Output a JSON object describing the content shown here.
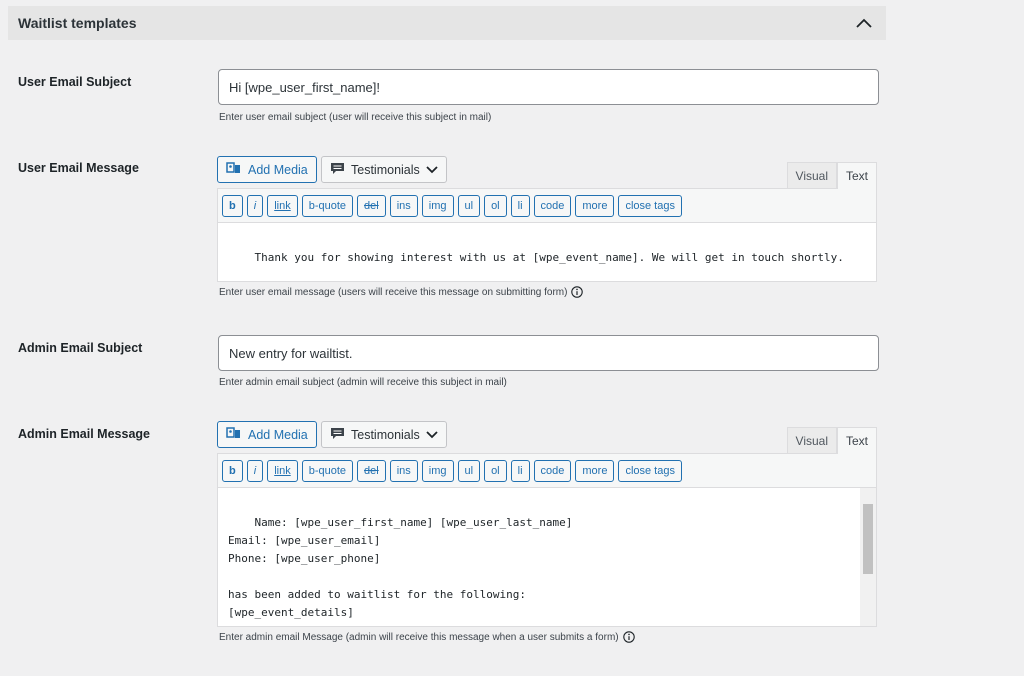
{
  "panel": {
    "title": "Waitlist templates",
    "collapse_icon": "chevron-up-icon"
  },
  "user_subject": {
    "label": "User Email Subject",
    "value": "Hi [wpe_user_first_name]!",
    "help": "Enter user email subject (user will receive this subject in mail)"
  },
  "user_message": {
    "label": "User Email Message",
    "add_media": "Add Media",
    "testimonials": "Testimonials",
    "tab_visual": "Visual",
    "tab_text": "Text",
    "quicktags": [
      "b",
      "i",
      "link",
      "b-quote",
      "del",
      "ins",
      "img",
      "ul",
      "ol",
      "li",
      "code",
      "more",
      "close tags"
    ],
    "content": "Thank you for showing interest with us at [wpe_event_name]. We will get in touch shortly.",
    "help": "Enter user email message (users will receive this message on submitting form)"
  },
  "admin_subject": {
    "label": "Admin Email Subject",
    "value": "New entry for wailtist.",
    "help": "Enter admin email subject (admin will receive this subject in mail)"
  },
  "admin_message": {
    "label": "Admin Email Message",
    "add_media": "Add Media",
    "testimonials": "Testimonials",
    "tab_visual": "Visual",
    "tab_text": "Text",
    "quicktags": [
      "b",
      "i",
      "link",
      "b-quote",
      "del",
      "ins",
      "img",
      "ul",
      "ol",
      "li",
      "code",
      "more",
      "close tags"
    ],
    "content": "Name: [wpe_user_first_name] [wpe_user_last_name]\nEmail: [wpe_user_email]\nPhone: [wpe_user_phone]\n\nhas been added to waitlist for the following:\n[wpe_event_details]",
    "help": "Enter admin email Message (admin will receive this message when a user submits a form)"
  },
  "colors": {
    "accent": "#2271b1",
    "background": "#f0f0f1",
    "header": "#e5e5e5"
  }
}
